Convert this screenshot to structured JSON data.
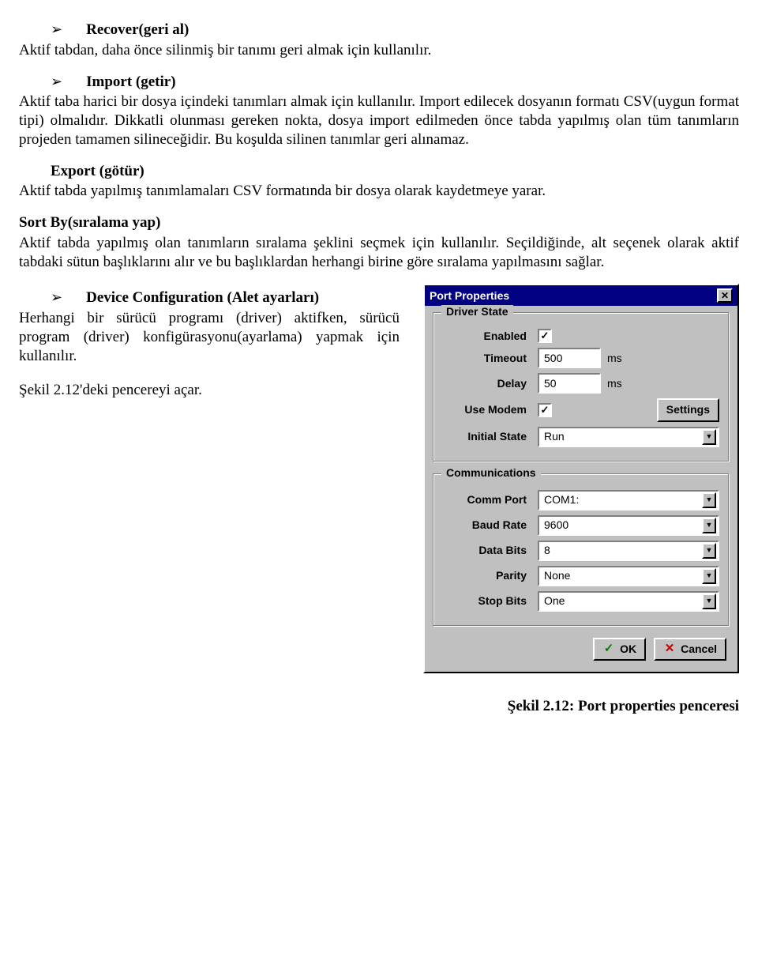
{
  "sections": {
    "recover": {
      "title": "Recover(geri al)",
      "body": "Aktif tabdan, daha önce silinmiş bir tanımı geri almak için kullanılır."
    },
    "import": {
      "title": "Import (getir)",
      "body": "Aktif taba harici bir dosya içindeki tanımları almak için kullanılır. Import edilecek dosyanın formatı CSV(uygun format tipi) olmalıdır. Dikkatli olunması gereken nokta, dosya import edilmeden önce tabda yapılmış olan tüm tanımların projeden tamamen silineceğidir. Bu koşulda silinen tanımlar geri alınamaz."
    },
    "export": {
      "title": "Export (götür)",
      "body": "Aktif tabda yapılmış tanımlamaları CSV formatında bir dosya olarak kaydetmeye yarar."
    },
    "sortby": {
      "title": "Sort By(sıralama yap)",
      "body": "Aktif tabda yapılmış olan tanımların sıralama şeklini seçmek için kullanılır. Seçildiğinde, alt seçenek olarak aktif tabdaki sütun başlıklarını alır ve bu başlıklardan herhangi birine göre sıralama yapılmasını sağlar."
    },
    "devcfg": {
      "title": "Device Configuration (Alet ayarları)",
      "body": "Herhangi bir sürücü programı (driver) aktifken, sürücü program (driver) konfigürasyonu(ayarlama) yapmak için kullanılır.",
      "extra": "Şekil 2.12'deki pencereyi açar."
    }
  },
  "dialog": {
    "title": "Port Properties",
    "group1": {
      "legend": "Driver State",
      "enabled_label": "Enabled",
      "enabled_checked": "✓",
      "timeout_label": "Timeout",
      "timeout_value": "500",
      "timeout_unit": "ms",
      "delay_label": "Delay",
      "delay_value": "50",
      "delay_unit": "ms",
      "use_modem_label": "Use Modem",
      "use_modem_checked": "✓",
      "settings_btn": "Settings",
      "initial_state_label": "Initial State",
      "initial_state_value": "Run"
    },
    "group2": {
      "legend": "Communications",
      "comm_port_label": "Comm Port",
      "comm_port_value": "COM1:",
      "baud_label": "Baud Rate",
      "baud_value": "9600",
      "data_bits_label": "Data Bits",
      "data_bits_value": "8",
      "parity_label": "Parity",
      "parity_value": "None",
      "stop_bits_label": "Stop Bits",
      "stop_bits_value": "One"
    },
    "ok": "OK",
    "cancel": "Cancel"
  },
  "caption": "Şekil 2.12: Port properties penceresi",
  "arrow": "➢",
  "dd_glyph": "▼"
}
